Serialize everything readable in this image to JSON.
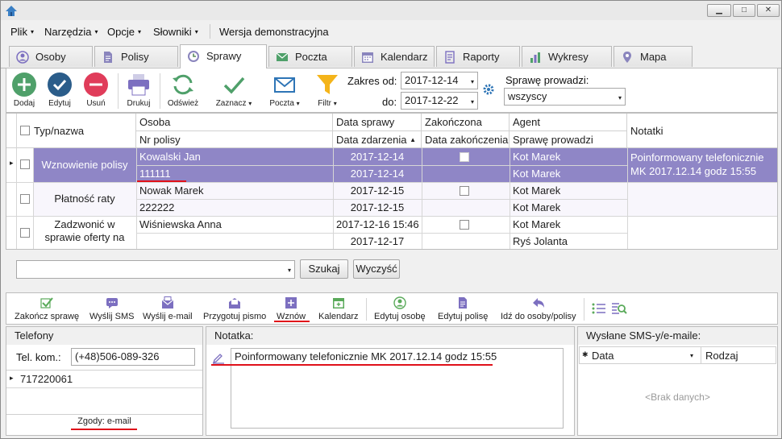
{
  "window": {
    "min_icon": "minimize-icon",
    "max_icon": "maximize-icon",
    "close_icon": "close-icon",
    "min": "▁",
    "max": "□",
    "close": "✕"
  },
  "menu": [
    "Plik",
    "Narzędzia",
    "Opcje",
    "Słowniki"
  ],
  "menu_arrow": "▾",
  "version_label": "Wersja demonstracyjna",
  "tabs": [
    {
      "label": "Osoby",
      "icon": "person-icon"
    },
    {
      "label": "Polisy",
      "icon": "document-icon"
    },
    {
      "label": "Sprawy",
      "icon": "clock-icon"
    },
    {
      "label": "Poczta",
      "icon": "mail-icon"
    },
    {
      "label": "Kalendarz",
      "icon": "calendar-icon"
    },
    {
      "label": "Raporty",
      "icon": "report-icon"
    },
    {
      "label": "Wykresy",
      "icon": "bar-chart-icon"
    },
    {
      "label": "Mapa",
      "icon": "map-pin-icon"
    }
  ],
  "active_tab": "Sprawy",
  "toolbar": {
    "add": "Dodaj",
    "edit": "Edytuj",
    "delete": "Usuń",
    "print": "Drukuj",
    "refresh": "Odśwież",
    "mark": "Zaznacz",
    "mail": "Poczta",
    "filter": "Filtr",
    "range_from_label": "Zakres od:",
    "range_from": "2017-12-14",
    "range_to_label": "do:",
    "range_to": "2017-12-22",
    "handler_label": "Sprawę prowadzi:",
    "handler_value": "wszyscy"
  },
  "grid": {
    "headers": {
      "type": "Typ/nazwa",
      "person": "Osoba",
      "policy": "Nr polisy",
      "case_date": "Data sprawy",
      "event_date": "Data zdarzenia",
      "sort_arrow": "▲",
      "done": "Zakończona",
      "done_date": "Data zakończenia",
      "agent": "Agent",
      "handler": "Sprawę prowadzi",
      "notes": "Notatki"
    },
    "rows": [
      {
        "type": "Wznowienie polisy",
        "person": "Kowalski Jan",
        "policy": "111111",
        "case_date": "2017-12-14",
        "event_date": "2017-12-14",
        "agent": "Kot Marek",
        "handler": "Kot Marek",
        "note": "Poinformowany telefonicznie MK 2017.12.14 godz 15:55"
      },
      {
        "type": "Płatność raty",
        "person": "Nowak  Marek",
        "policy": "222222",
        "case_date": "2017-12-15",
        "event_date": "2017-12-15",
        "agent": "Kot Marek",
        "handler": "Kot Marek",
        "note": ""
      },
      {
        "type": "Zadzwonić w sprawie oferty na",
        "person": "Wiśniewska Anna",
        "policy": "",
        "case_date": "2017-12-16 15:46",
        "event_date": "2017-12-17",
        "agent": "Kot Marek",
        "handler": "Ryś Jolanta",
        "note": ""
      }
    ],
    "row_indicator": "▸"
  },
  "search": {
    "value": "",
    "search_label": "Szukaj",
    "clear_label": "Wyczyść"
  },
  "actions": [
    {
      "label": "Zakończ sprawę",
      "icon": "check-icon",
      "color": "#5aaa5a"
    },
    {
      "label": "Wyślij SMS",
      "icon": "sms-icon",
      "color": "#7c6fc0"
    },
    {
      "label": "Wyślij e-mail",
      "icon": "email-icon",
      "color": "#7c6fc0"
    },
    {
      "label": "Przygotuj pismo",
      "icon": "letter-icon",
      "color": "#7c6fc0"
    },
    {
      "label": "Wznów",
      "icon": "resume-icon",
      "color": "#7c6fc0"
    },
    {
      "label": "Kalendarz",
      "icon": "calendar-icon",
      "color": "#5aaa5a"
    },
    {
      "label": "Edytuj osobę",
      "icon": "person-icon",
      "color": "#5aaa5a"
    },
    {
      "label": "Edytuj polisę",
      "icon": "document-icon",
      "color": "#7c6fc0"
    },
    {
      "label": "Idź do osoby/polisy",
      "icon": "go-to-icon",
      "color": "#7c6fc0"
    }
  ],
  "phones": {
    "title": "Telefony",
    "mobile_label": "Tel. kom.:",
    "mobile": "(+48)506-089-326",
    "list": [
      "717220061"
    ],
    "consents": "Zgody: e-mail"
  },
  "note": {
    "title": "Notatka:",
    "text": "Poinformowany telefonicznie MK 2017.12.14 godz 15:55"
  },
  "sent": {
    "title": "Wysłane SMS-y/e-maile:",
    "col_date": "Data",
    "col_type": "Rodzaj",
    "star": "✱",
    "empty": "<Brak danych>"
  },
  "colors": {
    "selected_row": "#8f86c6",
    "accent_purple": "#7c6fc0",
    "accent_green": "#5aaa5a",
    "accent_red": "#e0101a",
    "accent_blue": "#2e75b6"
  }
}
